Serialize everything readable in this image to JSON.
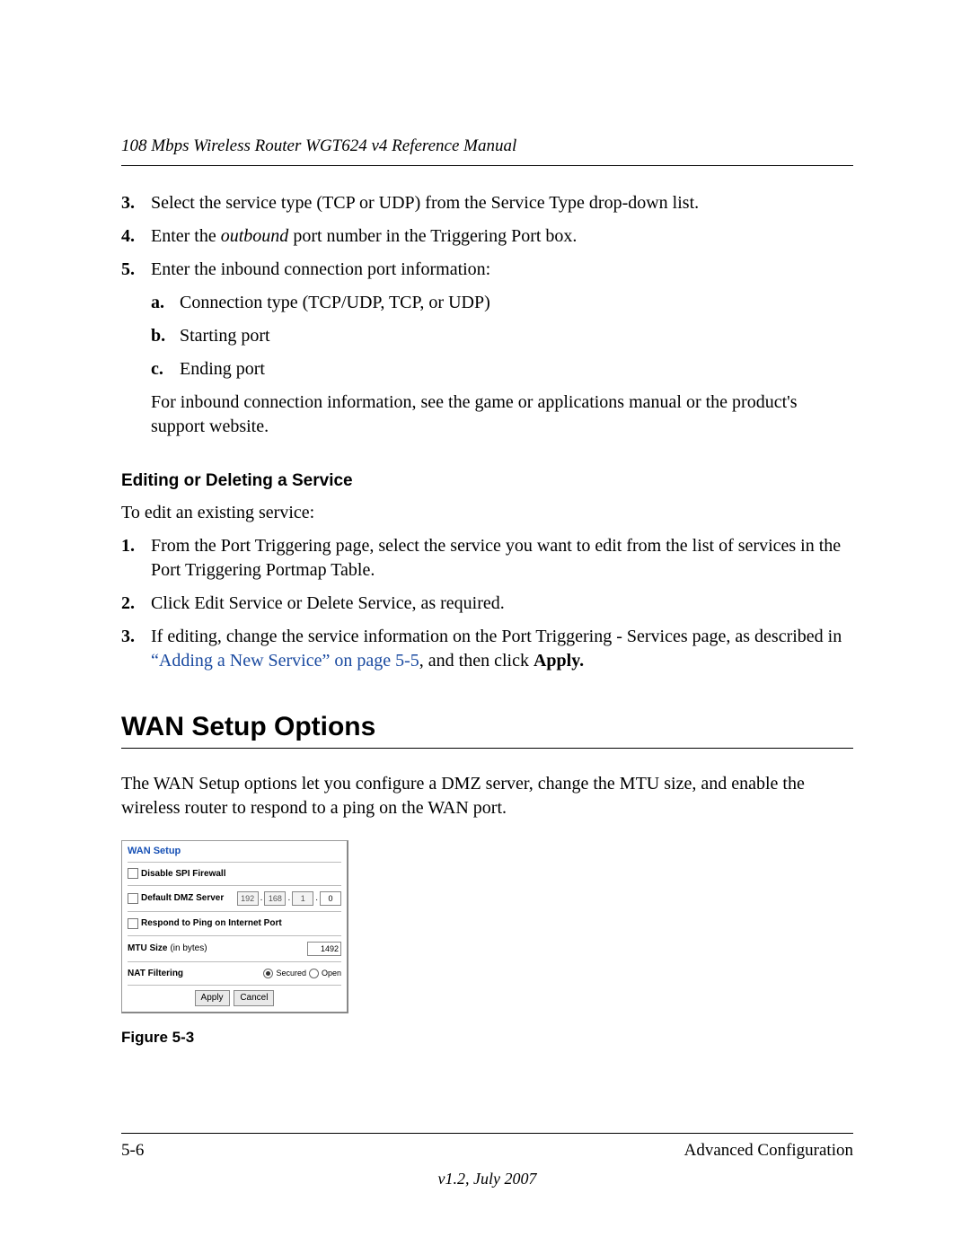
{
  "header": {
    "running": "108 Mbps Wireless Router WGT624 v4 Reference Manual"
  },
  "steps_top": [
    {
      "n": "3.",
      "text": "Select the service type (TCP or UDP) from the Service Type drop-down list."
    },
    {
      "n": "4.",
      "pre": "Enter the ",
      "em": "outbound",
      "post": " port number in the Triggering Port box."
    },
    {
      "n": "5.",
      "text": "Enter the inbound connection port information:"
    }
  ],
  "substeps": [
    {
      "n": "a.",
      "text": "Connection type (TCP/UDP, TCP, or UDP)"
    },
    {
      "n": "b.",
      "text": "Starting port"
    },
    {
      "n": "c.",
      "text": "Ending port"
    }
  ],
  "after_sub": "For inbound connection information, see the game or applications manual or the product's support website.",
  "sec_edit": {
    "heading": "Editing or Deleting a Service",
    "lead": "To edit an existing service:",
    "items": [
      {
        "n": "1.",
        "text": "From the Port Triggering page, select the service you want to edit from the list of services in the Port Triggering Portmap Table."
      },
      {
        "n": "2.",
        "text": "Click Edit Service or Delete Service, as required."
      },
      {
        "n": "3.",
        "pre": "If editing, change the service information on the Port Triggering - Services page, as described in ",
        "link": "“Adding a New Service” on page 5-5",
        "mid": ", and then click ",
        "bold": "Apply."
      }
    ]
  },
  "wan": {
    "heading": "WAN Setup Options",
    "intro": "The WAN Setup options let you configure a DMZ server, change the MTU size, and enable the wireless router to respond to a ping on the WAN port."
  },
  "shot": {
    "title": "WAN Setup",
    "rows": {
      "spi": "Disable SPI Firewall",
      "dmz": "Default DMZ Server",
      "ip": [
        "192",
        "168",
        "1",
        "0"
      ],
      "ping": "Respond to Ping on Internet Port",
      "mtu_label_pre": "MTU Size ",
      "mtu_label_unit": "(in bytes)",
      "mtu_value": "1492",
      "nat": "NAT Filtering",
      "nat_secured": "Secured",
      "nat_open": "Open"
    },
    "buttons": {
      "apply": "Apply",
      "cancel": "Cancel"
    }
  },
  "figure": "Figure 5-3",
  "footer": {
    "page": "5-6",
    "section": "Advanced Configuration",
    "version": "v1.2, July 2007"
  }
}
